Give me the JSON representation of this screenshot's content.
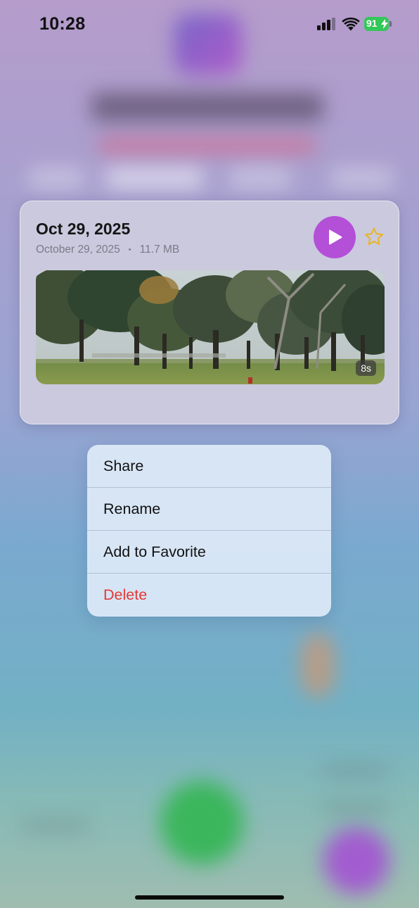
{
  "status_bar": {
    "time": "10:28",
    "battery_level": "91",
    "battery_color": "#34c759",
    "signal_bars": 3,
    "icons": [
      "cellular-signal-icon",
      "wifi-icon",
      "battery-charging-icon"
    ]
  },
  "recording_card": {
    "title": "Oct 29, 2025",
    "date": "October 29, 2025",
    "separator": "•",
    "size": "11.7 MB",
    "duration": "8s",
    "play_icon": "play-icon",
    "favorite_icon": "star-outline-icon",
    "accent_color": "#b44fd8",
    "star_color": "#e5b72e"
  },
  "context_menu": {
    "items": [
      {
        "label": "Share"
      },
      {
        "label": "Rename"
      },
      {
        "label": "Add to Favorite"
      },
      {
        "label": "Delete",
        "destructive": true
      }
    ],
    "destructive_color": "#e53935"
  }
}
